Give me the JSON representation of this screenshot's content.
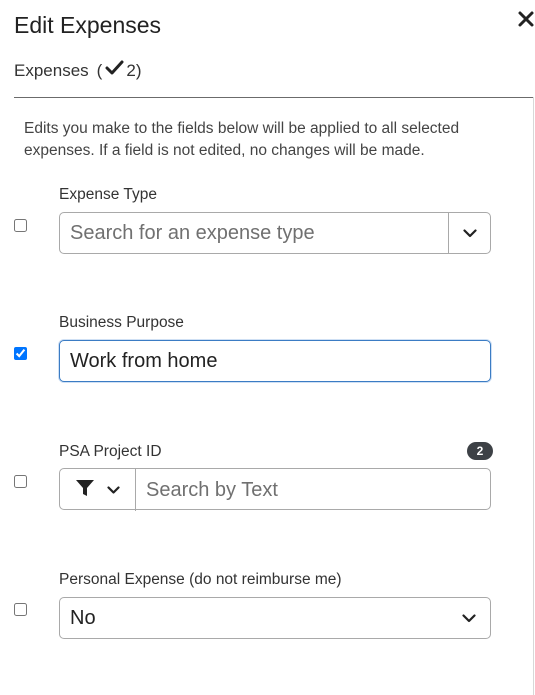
{
  "dialog": {
    "title": "Edit Expenses",
    "expenses_label": "Expenses",
    "selected_count": "2",
    "intro": "Edits you make to the fields below will be applied to all selected expenses. If a field is not edited, no changes will be made."
  },
  "fields": {
    "expense_type": {
      "label": "Expense Type",
      "placeholder": "Search for an expense type",
      "checked": false
    },
    "business_purpose": {
      "label": "Business Purpose",
      "value": "Work from home",
      "checked": true
    },
    "psa_project": {
      "label": "PSA Project ID",
      "badge": "2",
      "placeholder": "Search by Text",
      "checked": false
    },
    "personal_expense": {
      "label": "Personal Expense (do not reimburse me)",
      "value": "No",
      "checked": false
    }
  },
  "icons": {
    "close": "close-icon",
    "check": "checkmark-icon",
    "dropdown": "chevron-down-icon",
    "filter": "filter-icon"
  },
  "colors": {
    "focus_border": "#3b7cc4",
    "checkbox_checked": "#1a73e8",
    "badge_bg": "#3d4146"
  }
}
